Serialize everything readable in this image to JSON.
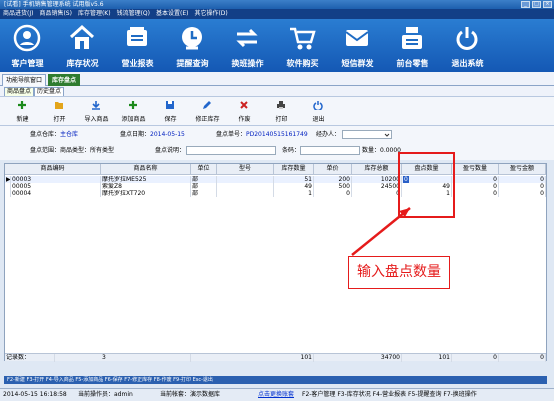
{
  "window": {
    "title": "[试看] 手机销售管理系统  试用版v5.6",
    "controls": [
      "_",
      "□",
      "×"
    ]
  },
  "menu": [
    "商品进货(J)",
    "商品销售(S)",
    "库存管理(K)",
    "钱流管理(Q)",
    "基本设置(E)",
    "其它操作(D)"
  ],
  "toolbar": [
    {
      "label": "客户管理",
      "icon": "customer-icon"
    },
    {
      "label": "库存状况",
      "icon": "warehouse-icon"
    },
    {
      "label": "营业报表",
      "icon": "report-icon"
    },
    {
      "label": "提醒查询",
      "icon": "reminder-icon"
    },
    {
      "label": "换班操作",
      "icon": "swap-icon"
    },
    {
      "label": "软件购买",
      "icon": "cart-icon"
    },
    {
      "label": "短信群发",
      "icon": "sms-icon"
    },
    {
      "label": "前台零售",
      "icon": "register-icon"
    },
    {
      "label": "退出系统",
      "icon": "power-icon"
    }
  ],
  "tabs": {
    "nav": "功能导航窗口",
    "active": "库存盘点"
  },
  "subtabs": [
    "商品盘点",
    "历史盘点"
  ],
  "actions": [
    {
      "label": "新建",
      "icon": "plus-icon",
      "color": "#1b8a1b"
    },
    {
      "label": "打开",
      "icon": "folder-icon",
      "color": "#e3a51b"
    },
    {
      "label": "导入商品",
      "icon": "import-icon",
      "color": "#2266cc"
    },
    {
      "label": "添加商品",
      "icon": "plus-icon",
      "color": "#1b8a1b"
    },
    {
      "label": "保存",
      "icon": "save-icon",
      "color": "#2266cc"
    },
    {
      "label": "修正库存",
      "icon": "edit-icon",
      "color": "#2266cc"
    },
    {
      "label": "作废",
      "icon": "cancel-icon",
      "color": "#cc2222"
    },
    {
      "label": "打印",
      "icon": "print-icon",
      "color": "#444444"
    },
    {
      "label": "退出",
      "icon": "exit-icon",
      "color": "#2266cc"
    }
  ],
  "form": {
    "warehouse_label": "盘点仓库：",
    "warehouse_value": "主仓库",
    "date_label": "盘点日期：",
    "date_value": "2014-05-15",
    "number_label": "盘点单号：",
    "number_value": "PD20140515161749",
    "handler_label": "经办人：",
    "scope_label": "盘点范围：",
    "scope_value": "商品类型：所有类型",
    "note_label": "盘点说明：",
    "barcode_label": "条码：",
    "quantity_label": "数量：",
    "quantity_value": "0.0000"
  },
  "grid": {
    "columns": [
      "商品编码",
      "商品名称",
      "单位",
      "型号",
      "库存数量",
      "单价",
      "库存总额",
      "盘点数量",
      "盈亏数量",
      "盈亏金额"
    ],
    "rows": [
      {
        "marker": "▶",
        "code": "00003",
        "name": "摩托罗拉ME525",
        "unit": "部",
        "model": "",
        "stock": "51",
        "price": "200",
        "total": "10200",
        "count": "0",
        "diff_qty": "0",
        "diff_amt": "0"
      },
      {
        "marker": "",
        "code": "00005",
        "name": "索爱Z8",
        "unit": "部",
        "model": "",
        "stock": "49",
        "price": "500",
        "total": "24500",
        "count": "49",
        "diff_qty": "0",
        "diff_amt": "0"
      },
      {
        "marker": "",
        "code": "00004",
        "name": "摩托罗拉XT720",
        "unit": "部",
        "model": "",
        "stock": "1",
        "price": "0",
        "total": "0",
        "count": "1",
        "diff_qty": "0",
        "diff_amt": "0"
      }
    ],
    "footer": {
      "label": "记录数：",
      "count": "3",
      "stock": "101",
      "total": "34700",
      "count_sum": "101",
      "diff_qty": "0",
      "diff_amt": "0"
    }
  },
  "hotkeys": "F2-新建  F3-打开  F4-导入商品  F5-添加商品  F6-保存  F7-修正库存  F8-作废  F9-打印  Esc-退出",
  "status": {
    "datetime": "2014-05-15 16:18:58",
    "operator": "当前操作员：admin",
    "account": "当前帐套：演示数据库",
    "link": "点击更换账套",
    "shortcuts": "F2-客户管理  F3-库存状况  F4-营业报表  F5-提醒查询  F7-换班操作"
  },
  "annotation": {
    "callout": "输入盘点数量",
    "color": "#e51b1b"
  }
}
